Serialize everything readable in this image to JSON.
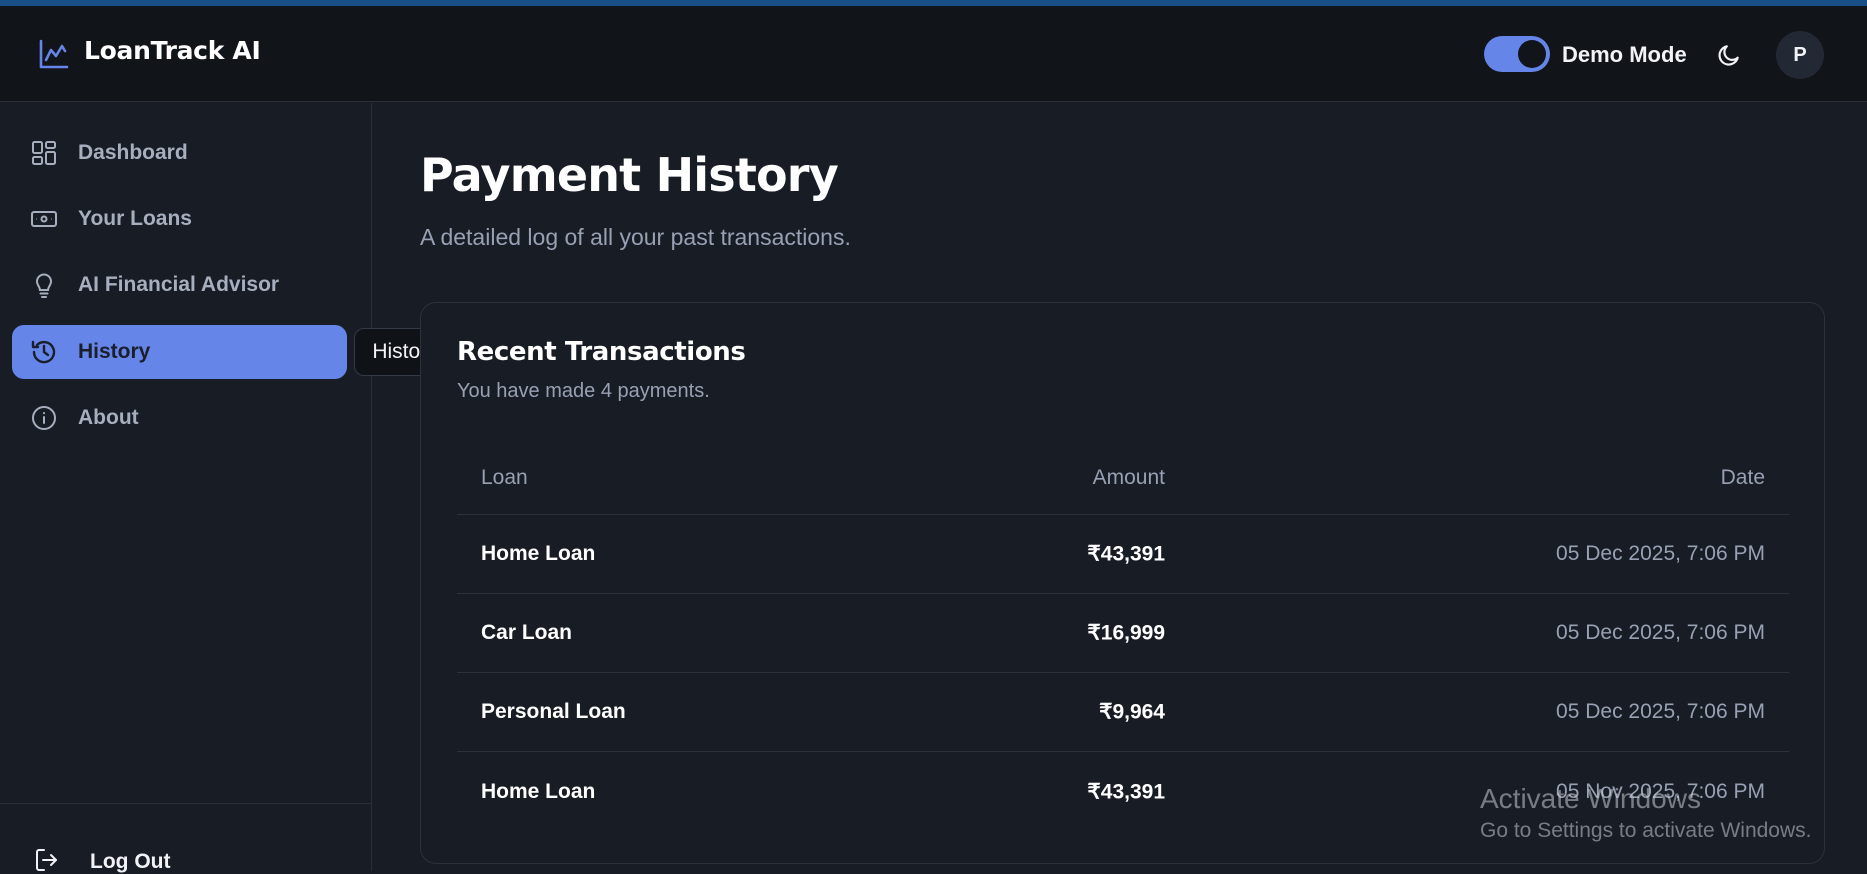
{
  "app": {
    "title": "LoanTrack AI",
    "accent_color": "#6586e8",
    "logo_icon": "line-chart-icon"
  },
  "header": {
    "demo_mode_label": "Demo Mode",
    "demo_mode_on": true,
    "theme_icon": "moon-icon",
    "avatar_initial": "P"
  },
  "sidebar": {
    "items": [
      {
        "label": "Dashboard",
        "icon": "dashboard-grid-icon",
        "active": false
      },
      {
        "label": "Your Loans",
        "icon": "banknote-icon",
        "active": false
      },
      {
        "label": "AI Financial Advisor",
        "icon": "lightbulb-icon",
        "active": false
      },
      {
        "label": "History",
        "icon": "history-icon",
        "active": true
      },
      {
        "label": "About",
        "icon": "info-icon",
        "active": false
      }
    ],
    "tooltip": "History",
    "logout_label": "Log Out",
    "logout_icon": "log-out-icon"
  },
  "main": {
    "title": "Payment History",
    "subtitle": "A detailed log of all your past transactions."
  },
  "card": {
    "title": "Recent Transactions",
    "subtitle": "You have made 4 payments.",
    "columns": {
      "loan": "Loan",
      "amount": "Amount",
      "date": "Date"
    },
    "rows": [
      {
        "loan": "Home Loan",
        "amount": "₹43,391",
        "date": "05 Dec 2025, 7:06 PM"
      },
      {
        "loan": "Car Loan",
        "amount": "₹16,999",
        "date": "05 Dec 2025, 7:06 PM"
      },
      {
        "loan": "Personal Loan",
        "amount": "₹9,964",
        "date": "05 Dec 2025, 7:06 PM"
      },
      {
        "loan": "Home Loan",
        "amount": "₹43,391",
        "date": "05 Nov 2025, 7:06 PM"
      }
    ]
  },
  "watermark": {
    "title": "Activate Windows",
    "subtitle": "Go to Settings to activate Windows."
  }
}
